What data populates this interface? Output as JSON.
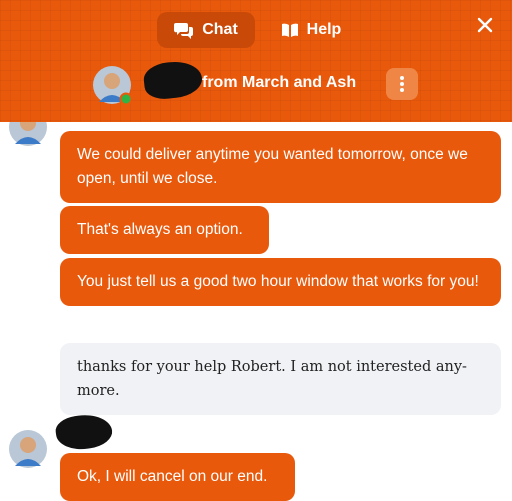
{
  "header": {
    "tabs": [
      {
        "label": "Chat",
        "icon": "chat-bubbles-icon",
        "active": true
      },
      {
        "label": "Help",
        "icon": "book-icon",
        "active": false
      }
    ],
    "agent_name_suffix": "from March and Ash",
    "agent_status_color": "#2fb344"
  },
  "messages": [
    {
      "sender": "agent",
      "text": "We could deliver anytime you wanted tomorrow, once we open, until we close."
    },
    {
      "sender": "agent",
      "text": "That's always an option."
    },
    {
      "sender": "agent",
      "text": "You just tell us a good two hour window that works for you!"
    },
    {
      "sender": "user",
      "text": "thanks for your help Robert. I am not interested any-more."
    },
    {
      "sender": "agent",
      "text": "Ok, I will cancel on our end."
    }
  ],
  "colors": {
    "brand": "#e8590c",
    "user_bubble": "#f0f2f5"
  }
}
